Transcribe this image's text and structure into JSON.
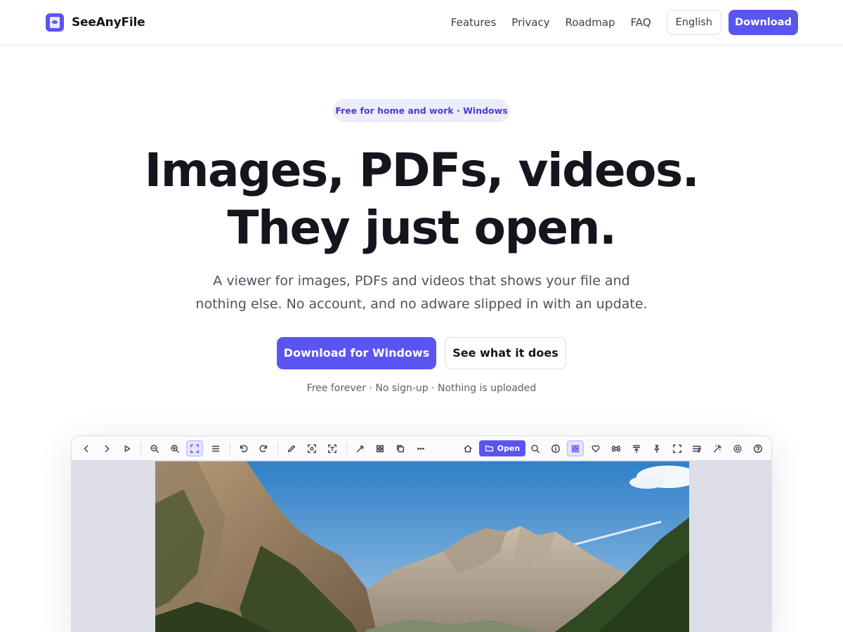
{
  "header": {
    "brand_name": "SeeAnyFile",
    "nav": [
      "Features",
      "Privacy",
      "Roadmap",
      "FAQ"
    ],
    "language": "English",
    "download_label": "Download"
  },
  "hero": {
    "pill": "Free for home and work · Windows",
    "title_line1": "Images, PDFs, videos.",
    "title_line2": "They just open.",
    "subtitle_line1": "A viewer for images, PDFs and videos that shows your file and",
    "subtitle_line2": "nothing else. No account, and no adware slipped in with an update.",
    "cta_primary": "Download for Windows",
    "cta_secondary": "See what it does",
    "fine_print": "Free forever · No sign-up · Nothing is uploaded"
  },
  "viewer": {
    "open_label": "Open",
    "toolbar_left": [
      "chevron-left-icon",
      "chevron-right-icon",
      "play-icon",
      "zoom-out-icon",
      "zoom-in-icon",
      "fit-screen-icon",
      "menu-icon",
      "rotate-left-icon",
      "rotate-right-icon",
      "pencil-icon",
      "crop-face-icon",
      "text-scan-icon",
      "eyedropper-icon",
      "grid-icon",
      "copy-icon",
      "more-icon"
    ],
    "toolbar_right": [
      "home-icon",
      "search-icon",
      "info-icon",
      "gallery-icon",
      "heart-icon",
      "command-icon",
      "upload-icon",
      "pin-icon",
      "fullscreen-icon",
      "sliders-icon",
      "magic-wand-icon",
      "gear-icon",
      "help-icon"
    ]
  },
  "colors": {
    "accent": "#5b55f0",
    "pill_bg": "#ececfd",
    "text": "#14151d"
  }
}
